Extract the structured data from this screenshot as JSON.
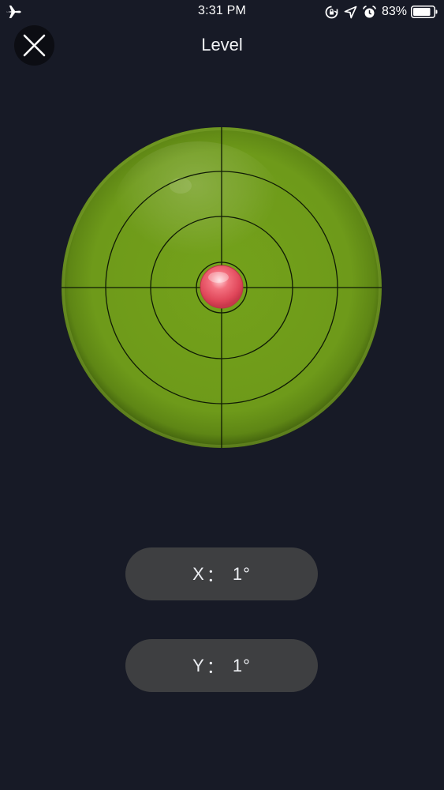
{
  "status_bar": {
    "time": "3:31 PM",
    "battery_percent": "83%",
    "icons": [
      "airplane-mode-icon",
      "orientation-lock-icon",
      "location-arrow-icon",
      "alarm-icon",
      "battery-icon"
    ]
  },
  "header": {
    "title": "Level",
    "close_icon": "close-icon"
  },
  "level": {
    "bubble_color": "#e64a5c",
    "surface_color": "#6f9a1b"
  },
  "readouts": {
    "x": {
      "label": "X",
      "separator": "：",
      "value": "1°"
    },
    "y": {
      "label": "Y",
      "separator": "：",
      "value": "1°"
    }
  }
}
